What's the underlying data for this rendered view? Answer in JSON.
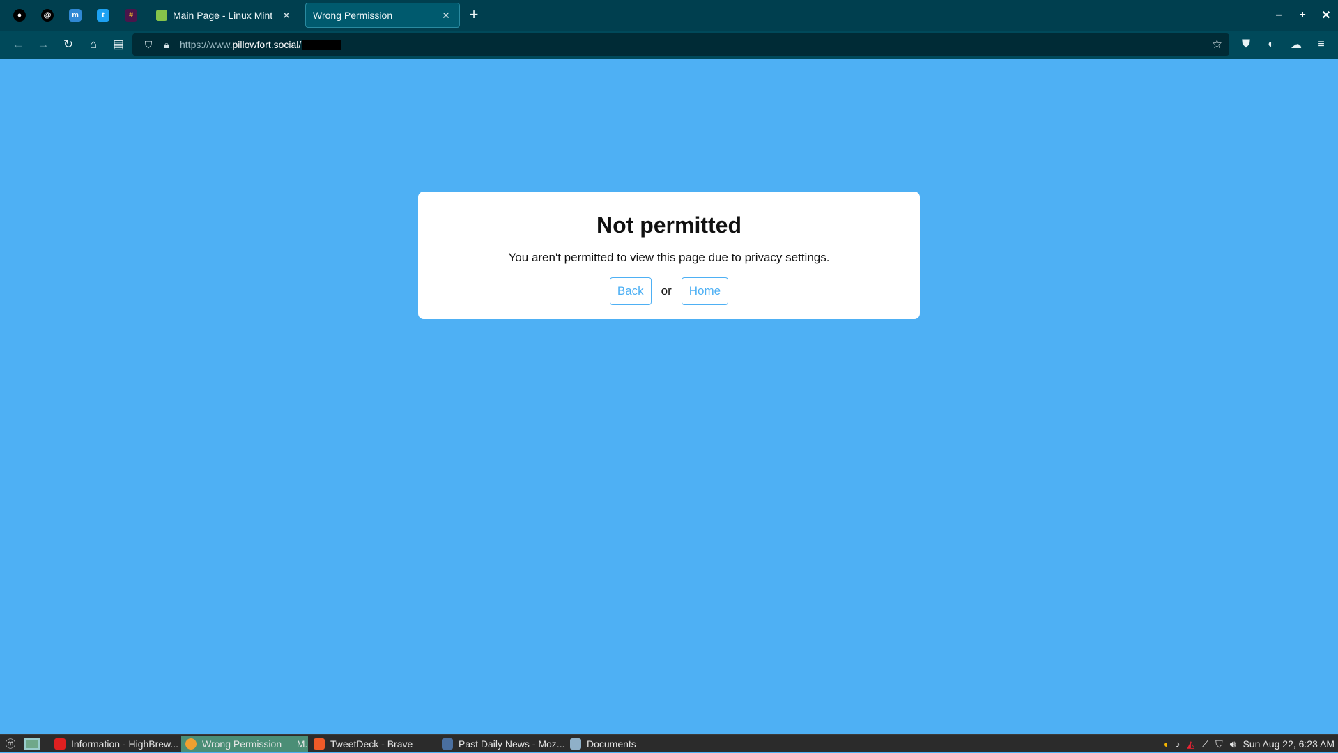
{
  "browser": {
    "pinned_tabs": [
      {
        "icon": "ghost-icon",
        "glyph": "●",
        "color": "#000000"
      },
      {
        "icon": "threads-icon",
        "glyph": "@",
        "color": "#000000"
      },
      {
        "icon": "mastodon-icon",
        "glyph": "m",
        "color": "#3088d4"
      },
      {
        "icon": "twitter-icon",
        "glyph": "t",
        "color": "#1da1f2"
      },
      {
        "icon": "slack-icon",
        "glyph": "#",
        "color": "#e01e5a"
      }
    ],
    "tabs": [
      {
        "label": "Main Page - Linux Mint",
        "close": "✕",
        "icon": "page-icon"
      },
      {
        "label": "Wrong Permission",
        "close": "✕",
        "icon": "page-icon"
      }
    ],
    "new_tab": "+",
    "window_controls": {
      "minimize": "–",
      "maximize": "+",
      "close": "✕"
    },
    "url": {
      "prefix": "https://www.",
      "host": "pillowfort.social/"
    }
  },
  "page": {
    "title": "Not permitted",
    "message": "You aren't permitted to view this page due to privacy settings.",
    "back_label": "Back",
    "or_label": "or",
    "home_label": "Home"
  },
  "taskbar": {
    "tasks": [
      {
        "label": "Information - HighBrew...",
        "color": "#e02020"
      },
      {
        "label": "Wrong Permission — M...",
        "color": "#f0a030"
      },
      {
        "label": "TweetDeck - Brave",
        "color": "#f05a28"
      },
      {
        "label": "Past Daily News - Moz...",
        "color": "#4a6fa0"
      },
      {
        "label": "Documents",
        "color": "#8fb0c8"
      }
    ],
    "clock": "Sun Aug 22,  6:23 AM"
  },
  "colors": {
    "page_background": "#4eb0f4",
    "tab_strip": "#003f4f",
    "nav_bar": "#00495a",
    "accent": "#4eb0f4"
  }
}
